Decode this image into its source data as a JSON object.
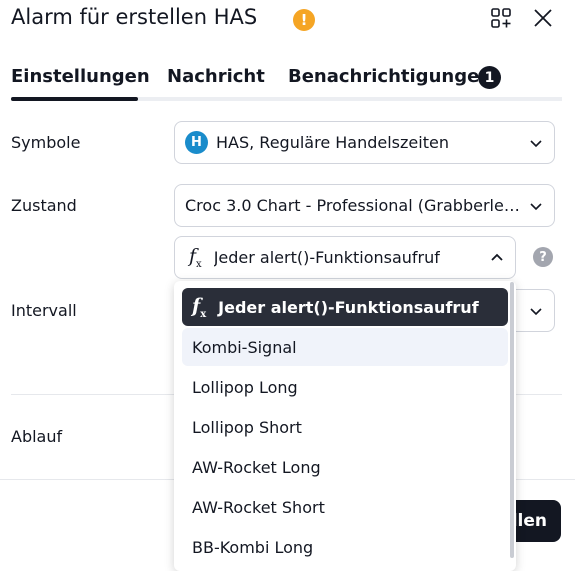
{
  "header": {
    "title": "Alarm für erstellen HAS",
    "warning_glyph": "!",
    "widgets_icon": "widgets-add-icon",
    "close_icon": "close-icon"
  },
  "tabs": [
    {
      "label": "Einstellungen"
    },
    {
      "label": "Nachricht"
    },
    {
      "label": "Benachrichtigungen",
      "badge": "1"
    }
  ],
  "form": {
    "symbol": {
      "label": "Symbole",
      "value": "HAS, Reguläre Handelszeiten"
    },
    "condition": {
      "label": "Zustand",
      "value": "Croc 3.0 Chart - Professional (Grabberlei..."
    },
    "trigger": {
      "value": "Jeder alert()-Funktionsaufruf"
    },
    "interval": {
      "label": "Intervall"
    },
    "expiry": {
      "label": "Ablauf"
    }
  },
  "help_glyph": "?",
  "create_button": {
    "label": "llen"
  },
  "dropdown": {
    "options": [
      {
        "label": "Jeder alert()-Funktionsaufruf",
        "selected": true
      },
      {
        "label": "Kombi-Signal"
      },
      {
        "label": "Lollipop Long"
      },
      {
        "label": "Lollipop Short"
      },
      {
        "label": "AW-Rocket Long"
      },
      {
        "label": "AW-Rocket Short"
      },
      {
        "label": "BB-Kombi Long"
      }
    ]
  },
  "colors": {
    "text": "#131722",
    "accent_dark": "#2a2e39",
    "warning": "#f5a524",
    "symbol_logo": "#1a8ccb",
    "border": "#d1d4dc"
  }
}
